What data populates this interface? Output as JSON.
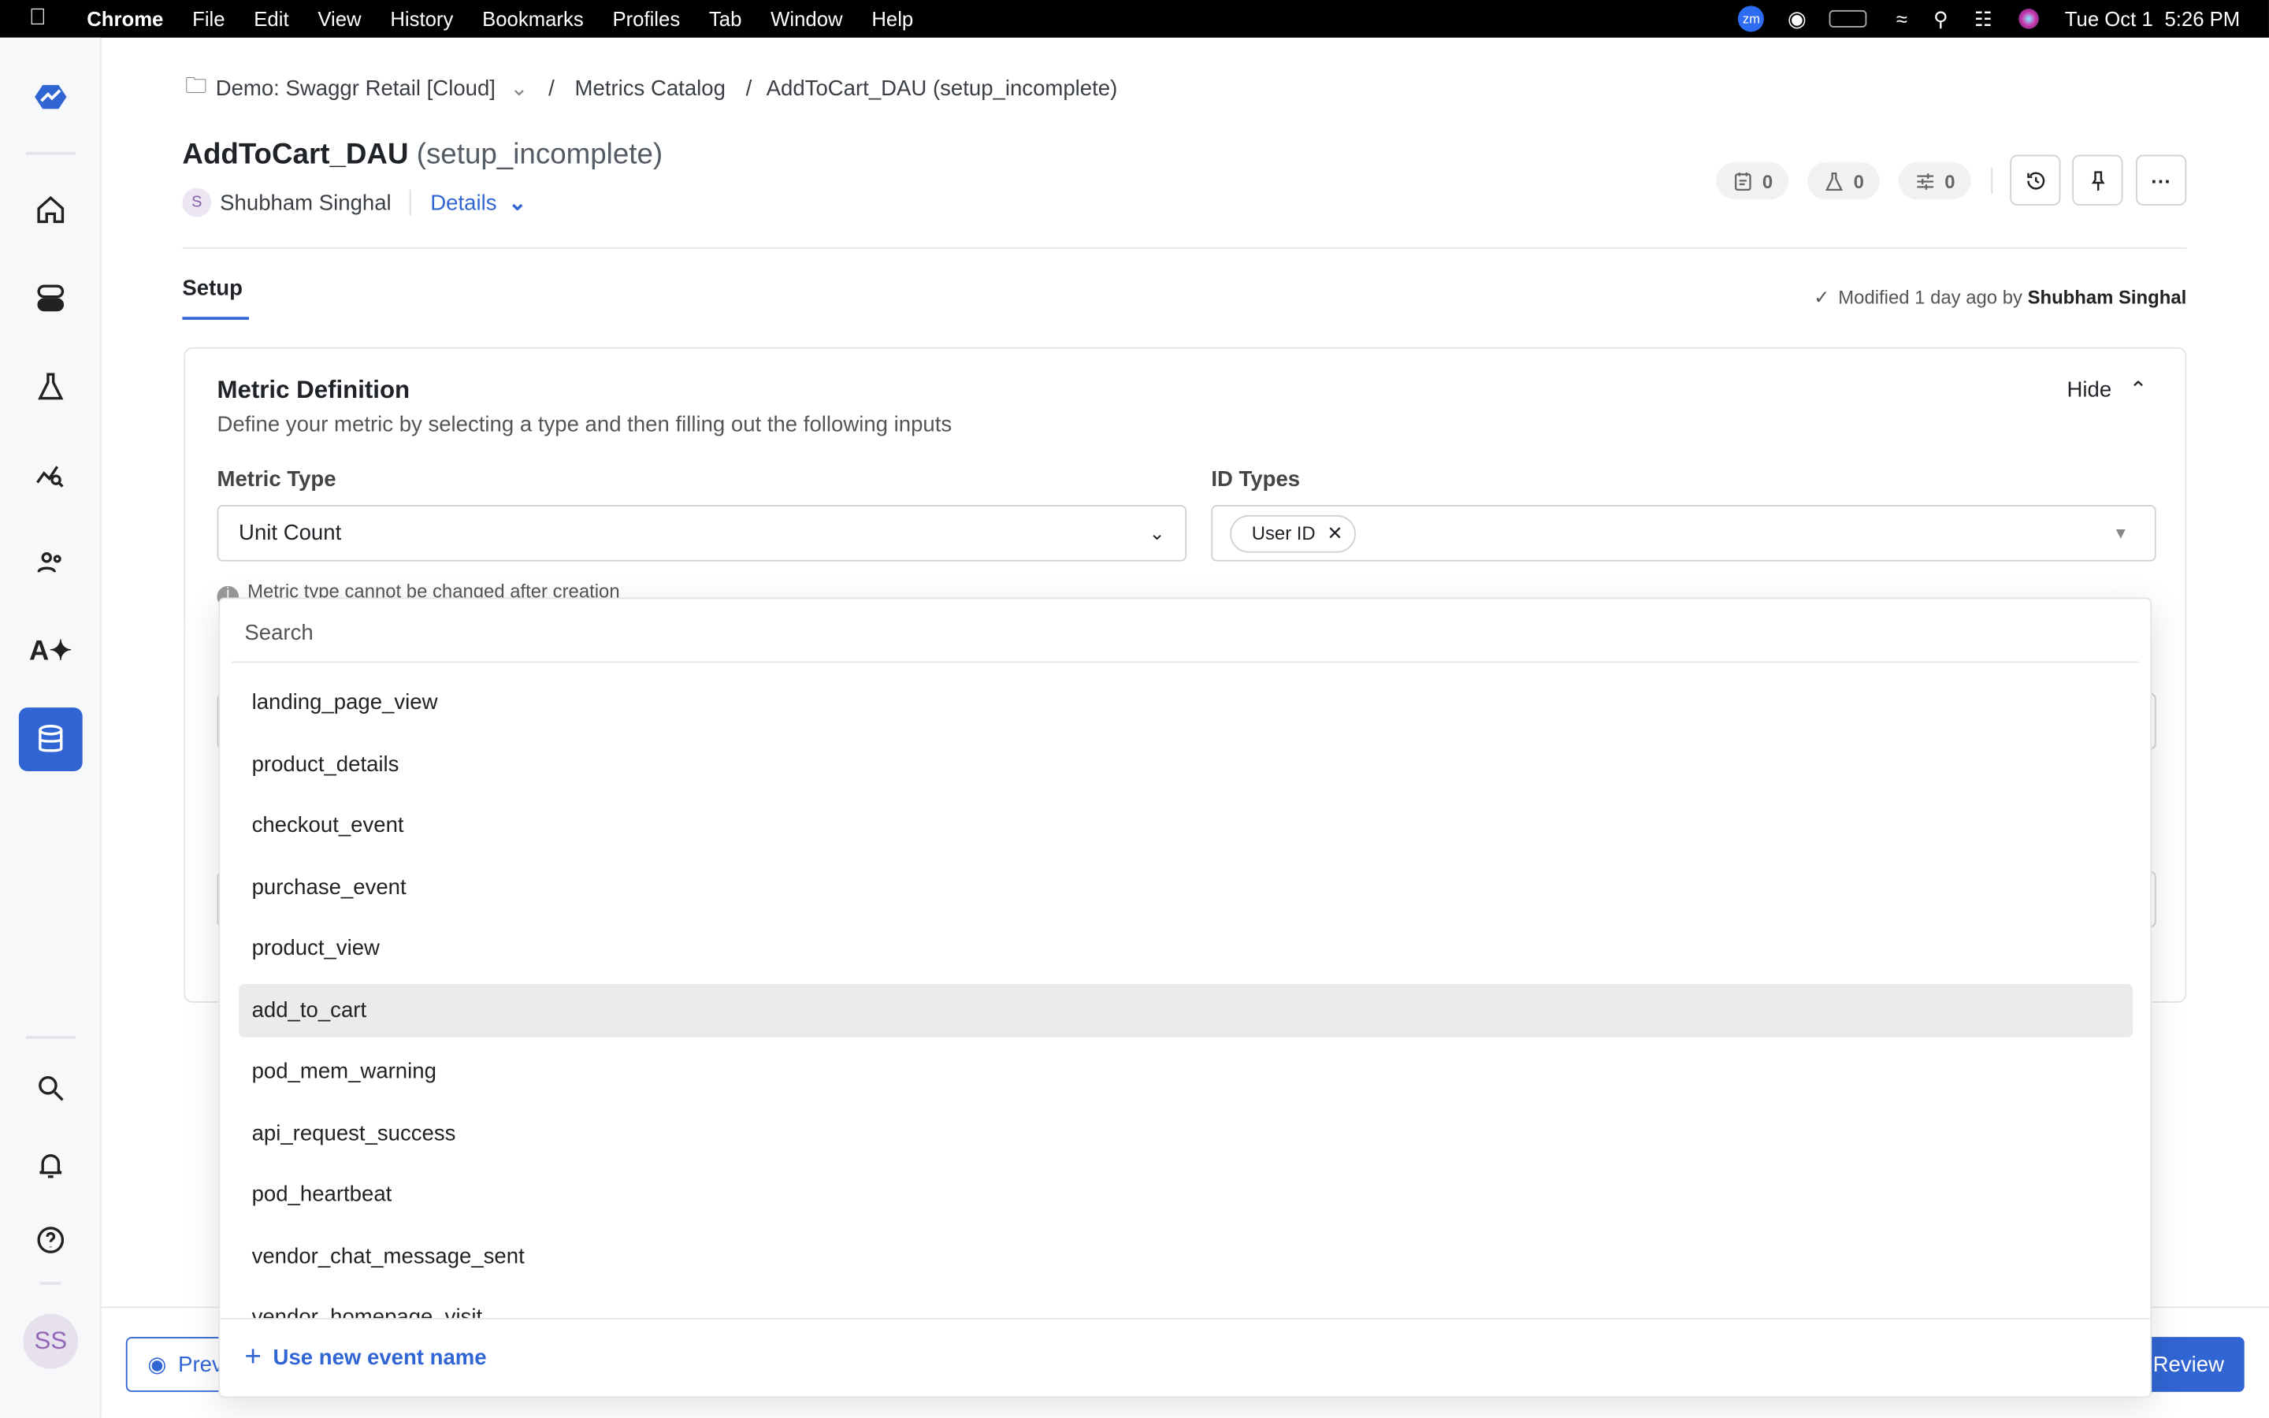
{
  "menubar": {
    "app": "Chrome",
    "items": [
      "File",
      "Edit",
      "View",
      "History",
      "Bookmarks",
      "Profiles",
      "Tab",
      "Window",
      "Help"
    ],
    "date": "Tue Oct 1",
    "time": "5:26 PM",
    "zoom_label": "zm"
  },
  "sidebar": {
    "avatar": "SS",
    "active_item": "metrics-catalog",
    "accent": "#3165d4"
  },
  "breadcrumb": {
    "project": "Demo: Swaggr Retail [Cloud]",
    "section": "Metrics Catalog",
    "current": "AddToCart_DAU (setup_incomplete)",
    "sep": "/"
  },
  "header": {
    "title": "AddToCart_DAU",
    "status": "(setup_incomplete)",
    "author_initial": "S",
    "author": "Shubham Singhal",
    "details_label": "Details",
    "counts": {
      "notes": "0",
      "experiments": "0",
      "configs": "0"
    }
  },
  "tabs": {
    "setup": "Setup"
  },
  "modified": {
    "text": "Modified 1 day ago by",
    "user": "Shubham Singhal"
  },
  "metric_definition": {
    "title": "Metric Definition",
    "subtitle": "Define your metric by selecting a type and then filling out the following inputs",
    "hide_label": "Hide",
    "metric_type_label": "Metric Type",
    "metric_type_value": "Unit Count",
    "id_types_label": "ID Types",
    "id_type_chip": "User ID",
    "info_text": "Metric type cannot be changed after creation"
  },
  "dropdown": {
    "search_placeholder": "Search",
    "options": [
      "landing_page_view",
      "product_details",
      "checkout_event",
      "purchase_event",
      "product_view",
      "add_to_cart",
      "pod_mem_warning",
      "api_request_success",
      "pod_heartbeat",
      "vendor_chat_message_sent",
      "vendor_homepage_visit"
    ],
    "highlighted": "add_to_cart",
    "footer_action": "Use new event name"
  },
  "footer": {
    "preview_label": "Preview",
    "review_label": "Review"
  }
}
